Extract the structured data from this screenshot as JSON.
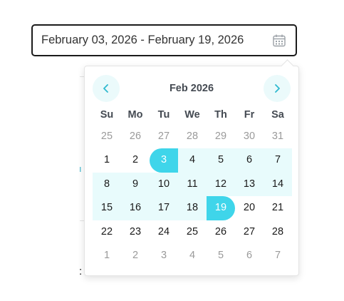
{
  "date_input": {
    "value": "February 03, 2026 - February 19, 2026",
    "icon": "calendar-icon"
  },
  "calendar": {
    "month_label": "Feb 2026",
    "prev_icon": "chevron-left-icon",
    "next_icon": "chevron-right-icon",
    "weekdays": [
      "Su",
      "Mo",
      "Tu",
      "We",
      "Th",
      "Fr",
      "Sa"
    ],
    "weeks": [
      [
        "25",
        "26",
        "27",
        "28",
        "29",
        "30",
        "31"
      ],
      [
        "1",
        "2",
        "3",
        "4",
        "5",
        "6",
        "7"
      ],
      [
        "8",
        "9",
        "10",
        "11",
        "12",
        "13",
        "14"
      ],
      [
        "15",
        "16",
        "17",
        "18",
        "19",
        "20",
        "21"
      ],
      [
        "22",
        "23",
        "24",
        "25",
        "26",
        "27",
        "28"
      ],
      [
        "1",
        "2",
        "3",
        "4",
        "5",
        "6",
        "7"
      ]
    ],
    "range_start_day": "3",
    "range_end_day": "19"
  },
  "colors": {
    "accent": "#3fd5ea",
    "range_fill": "#e8fbfc",
    "nav_button_bg": "#ebfafb"
  }
}
